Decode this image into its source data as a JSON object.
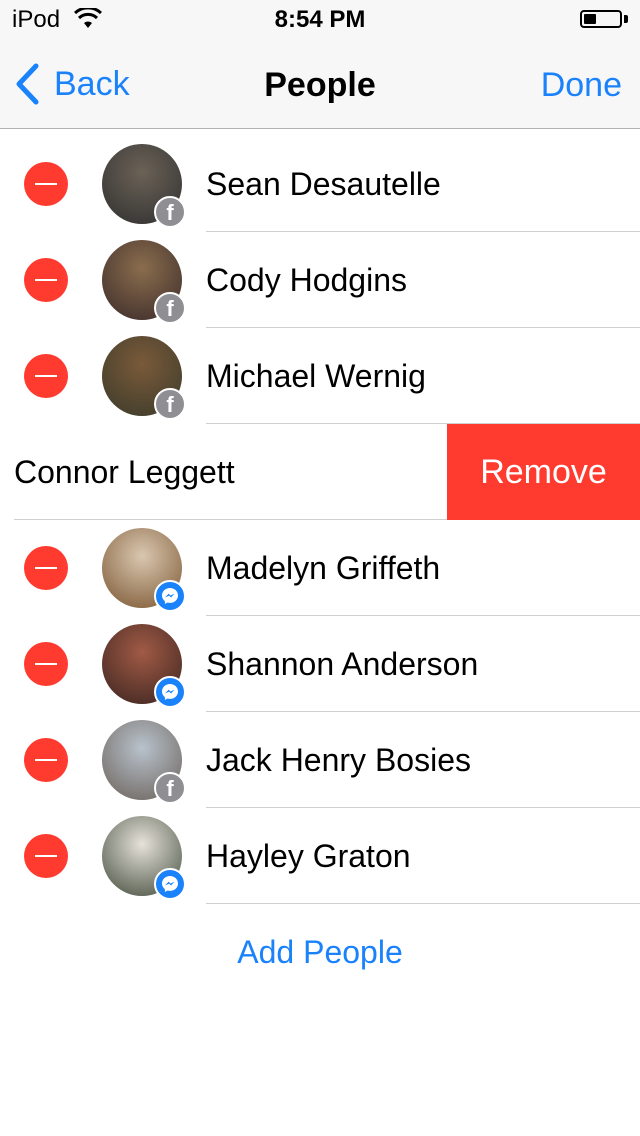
{
  "status_bar": {
    "carrier": "iPod",
    "time": "8:54 PM",
    "battery_level": 0.35,
    "wifi_icon": "wifi-icon"
  },
  "nav": {
    "back_label": "Back",
    "title": "People",
    "done_label": "Done"
  },
  "people": [
    {
      "name": "Sean Desautelle",
      "badge": "facebook",
      "avatar_colors": [
        "#6b6257",
        "#2f2f2f"
      ]
    },
    {
      "name": "Cody Hodgins",
      "badge": "facebook",
      "avatar_colors": [
        "#8a6d4d",
        "#3a2a2a"
      ]
    },
    {
      "name": "Michael Wernig",
      "badge": "facebook",
      "avatar_colors": [
        "#7a5a3a",
        "#3a3a2a"
      ]
    },
    {
      "name": "Connor Leggett",
      "swiped": true,
      "action_label": "Remove"
    },
    {
      "name": "Madelyn Griffeth",
      "badge": "messenger",
      "avatar_colors": [
        "#d9c7b0",
        "#7a5530"
      ]
    },
    {
      "name": "Shannon Anderson",
      "badge": "messenger",
      "avatar_colors": [
        "#a15a45",
        "#3a2420"
      ]
    },
    {
      "name": "Jack Henry Bosies",
      "badge": "facebook",
      "avatar_colors": [
        "#b8c2cc",
        "#6a6058"
      ]
    },
    {
      "name": "Hayley Graton",
      "badge": "messenger",
      "avatar_colors": [
        "#e6e2da",
        "#404a3a"
      ]
    }
  ],
  "add_people_label": "Add People",
  "colors": {
    "accent": "#1a82fb",
    "destructive": "#ff3b30",
    "badge_facebook": "#8e8e93",
    "badge_messenger": "#1a82fb"
  }
}
